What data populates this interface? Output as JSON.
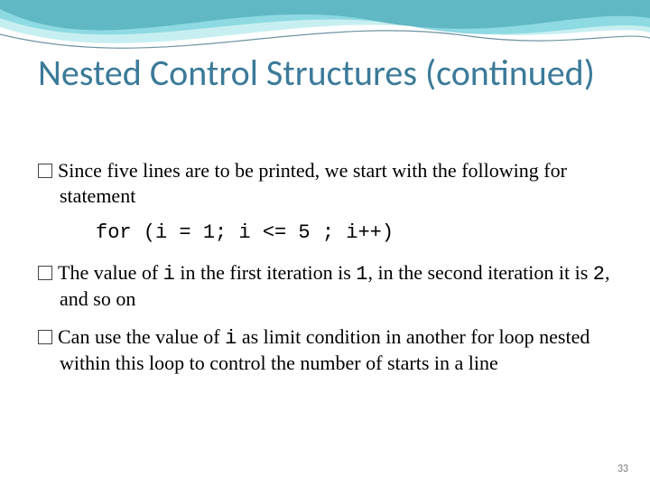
{
  "title": "Nested Control Structures (continued)",
  "bullets": {
    "b1_pre": "Since five lines are to be printed, we start with the following for statement",
    "code": "for (i = 1; i <= 5 ; i++)",
    "b2_pre": "The value of ",
    "b2_i1": "i",
    "b2_mid": " in the first iteration is ",
    "b2_one": "1",
    "b2_mid2": ", in the second iteration it is ",
    "b2_two": "2",
    "b2_end": ", and so on",
    "b3_pre": "Can use the value of ",
    "b3_i": "i",
    "b3_rest": " as limit condition in another for loop nested within this loop to control the number of starts in a line"
  },
  "page_number": "33"
}
